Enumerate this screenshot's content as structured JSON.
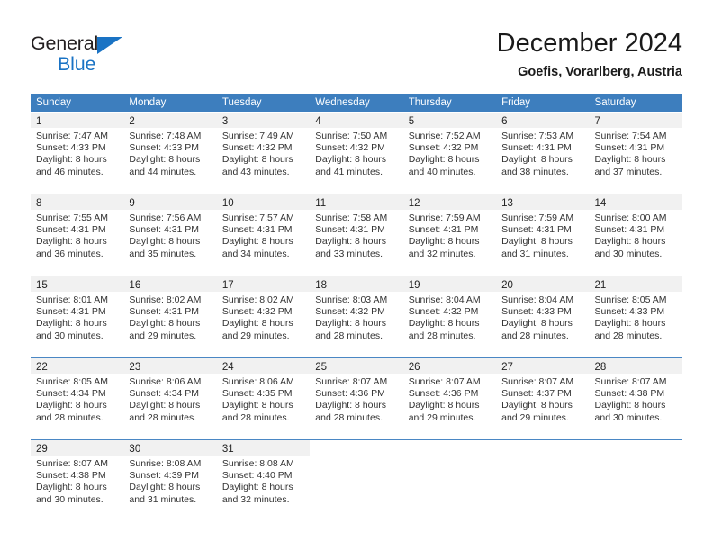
{
  "brand": {
    "name_top": "General",
    "name_bottom": "Blue",
    "accent_color": "#1a73c4",
    "triangle_icon": "brand-triangle-icon"
  },
  "header": {
    "title": "December 2024",
    "subtitle": "Goefis, Vorarlberg, Austria"
  },
  "theme": {
    "header_blue": "#3d7ebe",
    "row_border_blue": "#4a87c4",
    "daynum_band": "#f1f1f1",
    "text": "#333333"
  },
  "weekdays": [
    "Sunday",
    "Monday",
    "Tuesday",
    "Wednesday",
    "Thursday",
    "Friday",
    "Saturday"
  ],
  "weeks": [
    [
      {
        "day": "1",
        "sunrise": "Sunrise: 7:47 AM",
        "sunset": "Sunset: 4:33 PM",
        "daylight_line1": "Daylight: 8 hours",
        "daylight_line2": "and 46 minutes."
      },
      {
        "day": "2",
        "sunrise": "Sunrise: 7:48 AM",
        "sunset": "Sunset: 4:33 PM",
        "daylight_line1": "Daylight: 8 hours",
        "daylight_line2": "and 44 minutes."
      },
      {
        "day": "3",
        "sunrise": "Sunrise: 7:49 AM",
        "sunset": "Sunset: 4:32 PM",
        "daylight_line1": "Daylight: 8 hours",
        "daylight_line2": "and 43 minutes."
      },
      {
        "day": "4",
        "sunrise": "Sunrise: 7:50 AM",
        "sunset": "Sunset: 4:32 PM",
        "daylight_line1": "Daylight: 8 hours",
        "daylight_line2": "and 41 minutes."
      },
      {
        "day": "5",
        "sunrise": "Sunrise: 7:52 AM",
        "sunset": "Sunset: 4:32 PM",
        "daylight_line1": "Daylight: 8 hours",
        "daylight_line2": "and 40 minutes."
      },
      {
        "day": "6",
        "sunrise": "Sunrise: 7:53 AM",
        "sunset": "Sunset: 4:31 PM",
        "daylight_line1": "Daylight: 8 hours",
        "daylight_line2": "and 38 minutes."
      },
      {
        "day": "7",
        "sunrise": "Sunrise: 7:54 AM",
        "sunset": "Sunset: 4:31 PM",
        "daylight_line1": "Daylight: 8 hours",
        "daylight_line2": "and 37 minutes."
      }
    ],
    [
      {
        "day": "8",
        "sunrise": "Sunrise: 7:55 AM",
        "sunset": "Sunset: 4:31 PM",
        "daylight_line1": "Daylight: 8 hours",
        "daylight_line2": "and 36 minutes."
      },
      {
        "day": "9",
        "sunrise": "Sunrise: 7:56 AM",
        "sunset": "Sunset: 4:31 PM",
        "daylight_line1": "Daylight: 8 hours",
        "daylight_line2": "and 35 minutes."
      },
      {
        "day": "10",
        "sunrise": "Sunrise: 7:57 AM",
        "sunset": "Sunset: 4:31 PM",
        "daylight_line1": "Daylight: 8 hours",
        "daylight_line2": "and 34 minutes."
      },
      {
        "day": "11",
        "sunrise": "Sunrise: 7:58 AM",
        "sunset": "Sunset: 4:31 PM",
        "daylight_line1": "Daylight: 8 hours",
        "daylight_line2": "and 33 minutes."
      },
      {
        "day": "12",
        "sunrise": "Sunrise: 7:59 AM",
        "sunset": "Sunset: 4:31 PM",
        "daylight_line1": "Daylight: 8 hours",
        "daylight_line2": "and 32 minutes."
      },
      {
        "day": "13",
        "sunrise": "Sunrise: 7:59 AM",
        "sunset": "Sunset: 4:31 PM",
        "daylight_line1": "Daylight: 8 hours",
        "daylight_line2": "and 31 minutes."
      },
      {
        "day": "14",
        "sunrise": "Sunrise: 8:00 AM",
        "sunset": "Sunset: 4:31 PM",
        "daylight_line1": "Daylight: 8 hours",
        "daylight_line2": "and 30 minutes."
      }
    ],
    [
      {
        "day": "15",
        "sunrise": "Sunrise: 8:01 AM",
        "sunset": "Sunset: 4:31 PM",
        "daylight_line1": "Daylight: 8 hours",
        "daylight_line2": "and 30 minutes."
      },
      {
        "day": "16",
        "sunrise": "Sunrise: 8:02 AM",
        "sunset": "Sunset: 4:31 PM",
        "daylight_line1": "Daylight: 8 hours",
        "daylight_line2": "and 29 minutes."
      },
      {
        "day": "17",
        "sunrise": "Sunrise: 8:02 AM",
        "sunset": "Sunset: 4:32 PM",
        "daylight_line1": "Daylight: 8 hours",
        "daylight_line2": "and 29 minutes."
      },
      {
        "day": "18",
        "sunrise": "Sunrise: 8:03 AM",
        "sunset": "Sunset: 4:32 PM",
        "daylight_line1": "Daylight: 8 hours",
        "daylight_line2": "and 28 minutes."
      },
      {
        "day": "19",
        "sunrise": "Sunrise: 8:04 AM",
        "sunset": "Sunset: 4:32 PM",
        "daylight_line1": "Daylight: 8 hours",
        "daylight_line2": "and 28 minutes."
      },
      {
        "day": "20",
        "sunrise": "Sunrise: 8:04 AM",
        "sunset": "Sunset: 4:33 PM",
        "daylight_line1": "Daylight: 8 hours",
        "daylight_line2": "and 28 minutes."
      },
      {
        "day": "21",
        "sunrise": "Sunrise: 8:05 AM",
        "sunset": "Sunset: 4:33 PM",
        "daylight_line1": "Daylight: 8 hours",
        "daylight_line2": "and 28 minutes."
      }
    ],
    [
      {
        "day": "22",
        "sunrise": "Sunrise: 8:05 AM",
        "sunset": "Sunset: 4:34 PM",
        "daylight_line1": "Daylight: 8 hours",
        "daylight_line2": "and 28 minutes."
      },
      {
        "day": "23",
        "sunrise": "Sunrise: 8:06 AM",
        "sunset": "Sunset: 4:34 PM",
        "daylight_line1": "Daylight: 8 hours",
        "daylight_line2": "and 28 minutes."
      },
      {
        "day": "24",
        "sunrise": "Sunrise: 8:06 AM",
        "sunset": "Sunset: 4:35 PM",
        "daylight_line1": "Daylight: 8 hours",
        "daylight_line2": "and 28 minutes."
      },
      {
        "day": "25",
        "sunrise": "Sunrise: 8:07 AM",
        "sunset": "Sunset: 4:36 PM",
        "daylight_line1": "Daylight: 8 hours",
        "daylight_line2": "and 28 minutes."
      },
      {
        "day": "26",
        "sunrise": "Sunrise: 8:07 AM",
        "sunset": "Sunset: 4:36 PM",
        "daylight_line1": "Daylight: 8 hours",
        "daylight_line2": "and 29 minutes."
      },
      {
        "day": "27",
        "sunrise": "Sunrise: 8:07 AM",
        "sunset": "Sunset: 4:37 PM",
        "daylight_line1": "Daylight: 8 hours",
        "daylight_line2": "and 29 minutes."
      },
      {
        "day": "28",
        "sunrise": "Sunrise: 8:07 AM",
        "sunset": "Sunset: 4:38 PM",
        "daylight_line1": "Daylight: 8 hours",
        "daylight_line2": "and 30 minutes."
      }
    ],
    [
      {
        "day": "29",
        "sunrise": "Sunrise: 8:07 AM",
        "sunset": "Sunset: 4:38 PM",
        "daylight_line1": "Daylight: 8 hours",
        "daylight_line2": "and 30 minutes."
      },
      {
        "day": "30",
        "sunrise": "Sunrise: 8:08 AM",
        "sunset": "Sunset: 4:39 PM",
        "daylight_line1": "Daylight: 8 hours",
        "daylight_line2": "and 31 minutes."
      },
      {
        "day": "31",
        "sunrise": "Sunrise: 8:08 AM",
        "sunset": "Sunset: 4:40 PM",
        "daylight_line1": "Daylight: 8 hours",
        "daylight_line2": "and 32 minutes."
      },
      {
        "day": "",
        "sunrise": "",
        "sunset": "",
        "daylight_line1": "",
        "daylight_line2": ""
      },
      {
        "day": "",
        "sunrise": "",
        "sunset": "",
        "daylight_line1": "",
        "daylight_line2": ""
      },
      {
        "day": "",
        "sunrise": "",
        "sunset": "",
        "daylight_line1": "",
        "daylight_line2": ""
      },
      {
        "day": "",
        "sunrise": "",
        "sunset": "",
        "daylight_line1": "",
        "daylight_line2": ""
      }
    ]
  ]
}
